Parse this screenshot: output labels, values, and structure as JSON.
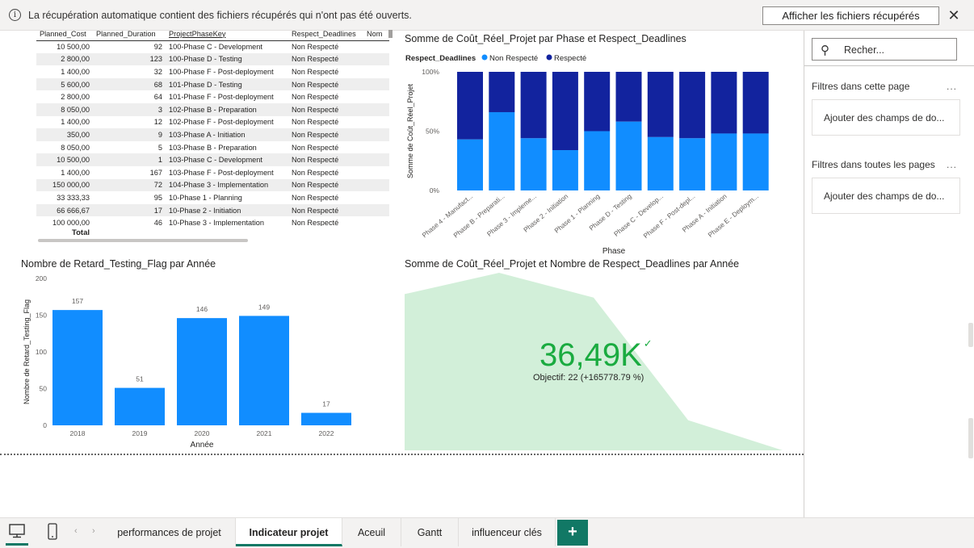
{
  "notification": {
    "message": "La récupération automatique contient des fichiers récupérés qui n'ont pas été ouverts.",
    "button": "Afficher les fichiers récupérés",
    "info_icon": "i",
    "close_icon": "✕"
  },
  "table": {
    "headers": [
      "Planned_Cost",
      "Planned_Duration",
      "ProjectPhaseKey",
      "Respect_Deadlines",
      "Nom"
    ],
    "rows": [
      [
        "10 500,00",
        "92",
        "100-Phase C - Development",
        "Non Respecté"
      ],
      [
        "2 800,00",
        "123",
        "100-Phase D - Testing",
        "Non Respecté"
      ],
      [
        "1 400,00",
        "32",
        "100-Phase F - Post-deployment",
        "Non Respecté"
      ],
      [
        "5 600,00",
        "68",
        "101-Phase D - Testing",
        "Non Respecté"
      ],
      [
        "2 800,00",
        "64",
        "101-Phase F - Post-deployment",
        "Non Respecté"
      ],
      [
        "8 050,00",
        "3",
        "102-Phase B - Preparation",
        "Non Respecté"
      ],
      [
        "1 400,00",
        "12",
        "102-Phase F - Post-deployment",
        "Non Respecté"
      ],
      [
        "350,00",
        "9",
        "103-Phase A - Initiation",
        "Non Respecté"
      ],
      [
        "8 050,00",
        "5",
        "103-Phase B - Preparation",
        "Non Respecté"
      ],
      [
        "10 500,00",
        "1",
        "103-Phase C - Development",
        "Non Respecté"
      ],
      [
        "1 400,00",
        "167",
        "103-Phase F - Post-deployment",
        "Non Respecté"
      ],
      [
        "150 000,00",
        "72",
        "104-Phase 3 - Implementation",
        "Non Respecté"
      ],
      [
        "33 333,33",
        "95",
        "10-Phase 1 - Planning",
        "Non Respecté"
      ],
      [
        "66 666,67",
        "17",
        "10-Phase 2 - Initiation",
        "Non Respecté"
      ],
      [
        "100 000,00",
        "46",
        "10-Phase 3 - Implementation",
        "Non Respecté"
      ]
    ],
    "total_label": "Total"
  },
  "stacked_chart": {
    "title": "Somme de Coût_Réel_Projet par Phase et Respect_Deadlines",
    "legend_title": "Respect_Deadlines",
    "ylabel": "Somme de Coût_Réel_Projet",
    "xlabel": "Phase",
    "yticks": [
      "100%",
      "50%",
      "0%"
    ],
    "categories": [
      "Phase 4 - Manufact...",
      "Phase B - Preparati...",
      "Phase 3 - Impleme...",
      "Phase 2 - Initiation",
      "Phase 1 - Planning",
      "Phase D - Testing",
      "Phase C - Develop...",
      "Phase F - Post-depl...",
      "Phase A - Initiation",
      "Phase E - Deploym..."
    ]
  },
  "bar_chart": {
    "title": "Nombre de Retard_Testing_Flag par Année",
    "ylabel": "Nombre de Retard_Testing_Flag",
    "xlabel": "Année",
    "yticks": [
      "200",
      "150",
      "100",
      "50",
      "0"
    ]
  },
  "kpi": {
    "title": "Somme de Coût_Réel_Projet et Nombre de Respect_Deadlines par Année",
    "value": "36,49K",
    "check": "✓",
    "goal": "Objectif: 22 (+165778.79 %)"
  },
  "filter_pane": {
    "search_placeholder": "Recher...",
    "this_page_label": "Filtres dans cette page",
    "this_page_box": "Ajouter des champs de do...",
    "all_pages_label": "Filtres dans toutes les pages",
    "all_pages_box": "Ajouter des champs de do...",
    "more": "..."
  },
  "tabs": {
    "items": [
      "performances de projet",
      "Indicateur projet",
      "Aceuil",
      "Gantt",
      "influenceur clés"
    ],
    "active": "Indicateur projet",
    "add": "+"
  },
  "colors": {
    "dark_blue": "#12239E",
    "light_blue": "#118DFF",
    "kpi_green": "#1AAB40",
    "area_fill": "#D2EFD9",
    "accent": "#117865"
  },
  "chart_data": [
    {
      "type": "bar",
      "title": "Somme de Coût_Réel_Projet par Phase et Respect_Deadlines",
      "stacked": "percent",
      "categories": [
        "Phase 4 - Manufact...",
        "Phase B - Preparati...",
        "Phase 3 - Impleme...",
        "Phase 2 - Initiation",
        "Phase 1 - Planning",
        "Phase D - Testing",
        "Phase C - Develop...",
        "Phase F - Post-depl...",
        "Phase A - Initiation",
        "Phase E - Deploym..."
      ],
      "series": [
        {
          "name": "Non Respecté",
          "values": [
            43,
            66,
            44,
            34,
            50,
            58,
            45,
            44,
            48,
            48
          ]
        },
        {
          "name": "Respecté",
          "values": [
            57,
            34,
            56,
            66,
            50,
            42,
            55,
            56,
            52,
            52
          ]
        }
      ],
      "xlabel": "Phase",
      "ylabel": "Somme de Coût_Réel_Projet",
      "ylim": [
        0,
        100
      ],
      "legend": "top-left"
    },
    {
      "type": "bar",
      "title": "Nombre de Retard_Testing_Flag par Année",
      "categories": [
        "2018",
        "2019",
        "2020",
        "2021",
        "2022"
      ],
      "values": [
        157,
        51,
        146,
        149,
        17
      ],
      "xlabel": "Année",
      "ylabel": "Nombre de Retard_Testing_Flag",
      "ylim": [
        0,
        200
      ]
    },
    {
      "type": "area",
      "title": "Somme de Coût_Réel_Projet et Nombre de Respect_Deadlines par Année",
      "trend": [
        0.88,
        1.0,
        0.86,
        0.17,
        0.0
      ],
      "kpi_value": "36,49K",
      "goal": "Objectif: 22 (+165778.79 %)"
    }
  ]
}
